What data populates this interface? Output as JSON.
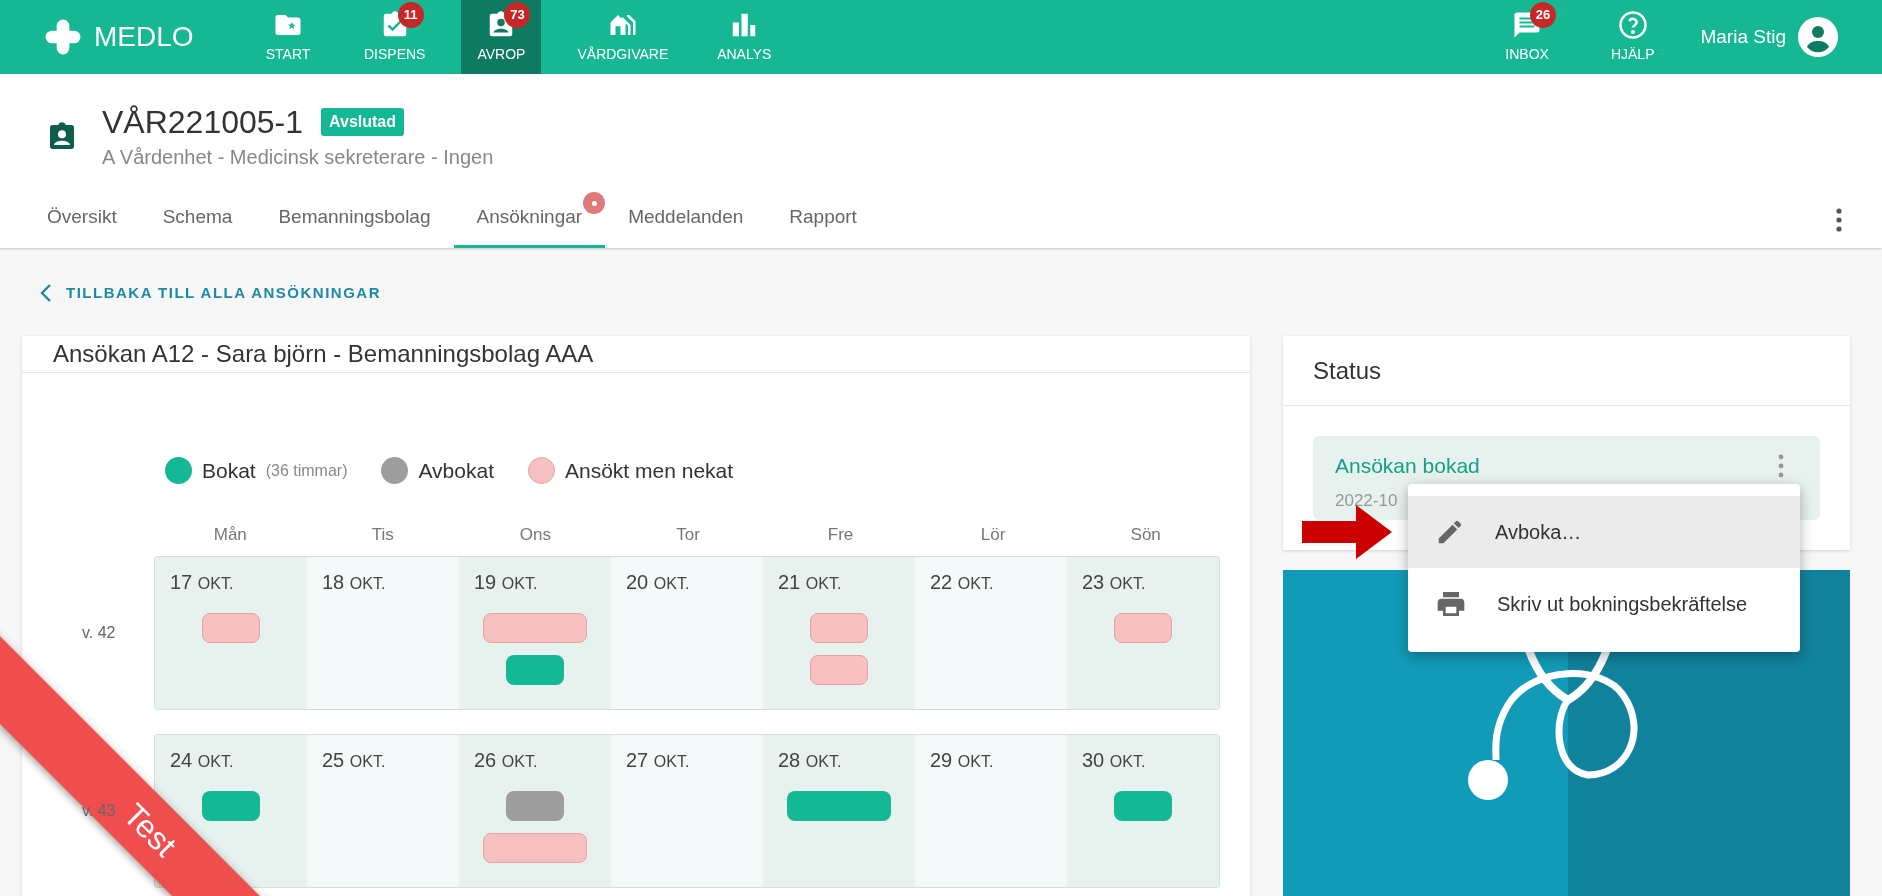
{
  "app": {
    "name": "MEDLO"
  },
  "nav": [
    {
      "label": "START",
      "selected": false
    },
    {
      "label": "DISPENS",
      "badge": "11",
      "selected": false
    },
    {
      "label": "AVROP",
      "badge": "73",
      "selected": true
    },
    {
      "label": "VÅRDGIVARE",
      "selected": false
    },
    {
      "label": "ANALYS",
      "selected": false
    }
  ],
  "nav_right": [
    {
      "label": "INBOX",
      "badge": "26"
    },
    {
      "label": "HJÄLP"
    }
  ],
  "user": {
    "name": "Maria Stig"
  },
  "page": {
    "title": "VÅR221005-1",
    "status": "Avslutad",
    "subtitle": "A Vårdenhet - Medicinsk sekreterare - Ingen"
  },
  "tabs": [
    {
      "label": "Översikt",
      "selected": false,
      "dot": false
    },
    {
      "label": "Schema",
      "selected": false,
      "dot": false
    },
    {
      "label": "Bemanningsbolag",
      "selected": false,
      "dot": false
    },
    {
      "label": "Ansökningar",
      "selected": true,
      "dot": true
    },
    {
      "label": "Meddelanden",
      "selected": false,
      "dot": false
    },
    {
      "label": "Rapport",
      "selected": false,
      "dot": false
    }
  ],
  "back_link": "TILLBAKA TILL ALLA ANSÖKNINGAR",
  "application": {
    "title": "Ansökan A12 - Sara björn - Bemanningsbolag AAA",
    "legend": [
      {
        "kind": "booked",
        "label": "Bokat",
        "note": "(36 timmar)"
      },
      {
        "kind": "cancelled",
        "label": "Avbokat"
      },
      {
        "kind": "denied",
        "label": "Ansökt men nekat"
      }
    ],
    "weekdays": [
      {
        "label": "Mån",
        "shaded": true
      },
      {
        "label": "Tis",
        "shaded": false
      },
      {
        "label": "Ons",
        "shaded": true
      },
      {
        "label": "Tor",
        "shaded": false
      },
      {
        "label": "Fre",
        "shaded": true
      },
      {
        "label": "Lör",
        "shaded": false
      },
      {
        "label": "Sön",
        "shaded": true
      }
    ],
    "weeks": [
      {
        "label": "v. 42",
        "days": [
          {
            "date": "17",
            "month": "OKT.",
            "shifts": [
              {
                "kind": "denied",
                "long": false
              }
            ]
          },
          {
            "date": "18",
            "month": "OKT."
          },
          {
            "date": "19",
            "month": "OKT.",
            "shifts": [
              {
                "kind": "denied",
                "long": true
              },
              {
                "kind": "booked",
                "long": false
              }
            ]
          },
          {
            "date": "20",
            "month": "OKT."
          },
          {
            "date": "21",
            "month": "OKT.",
            "shifts": [
              {
                "kind": "denied",
                "long": false
              },
              {
                "kind": "denied",
                "long": false
              }
            ]
          },
          {
            "date": "22",
            "month": "OKT."
          },
          {
            "date": "23",
            "month": "OKT.",
            "shifts": [
              {
                "kind": "denied",
                "long": false
              }
            ]
          }
        ]
      },
      {
        "label": "v. 43",
        "days": [
          {
            "date": "24",
            "month": "OKT.",
            "shifts": [
              {
                "kind": "booked",
                "long": false
              }
            ]
          },
          {
            "date": "25",
            "month": "OKT."
          },
          {
            "date": "26",
            "month": "OKT.",
            "shifts": [
              {
                "kind": "cancelled",
                "long": false
              },
              {
                "kind": "denied",
                "long": true
              }
            ]
          },
          {
            "date": "27",
            "month": "OKT."
          },
          {
            "date": "28",
            "month": "OKT.",
            "shifts": [
              {
                "kind": "booked",
                "long": true
              }
            ]
          },
          {
            "date": "29",
            "month": "OKT."
          },
          {
            "date": "30",
            "month": "OKT.",
            "shifts": [
              {
                "kind": "booked",
                "long": false
              }
            ]
          }
        ]
      }
    ]
  },
  "status": {
    "title": "Status",
    "item": {
      "label": "Ansökan bokad",
      "date": "2022-10"
    }
  },
  "menu": [
    {
      "label": "Avboka…",
      "selected": true
    },
    {
      "label": "Skriv ut bokningsbekräftelse",
      "selected": false
    }
  ],
  "ribbon": "Test"
}
